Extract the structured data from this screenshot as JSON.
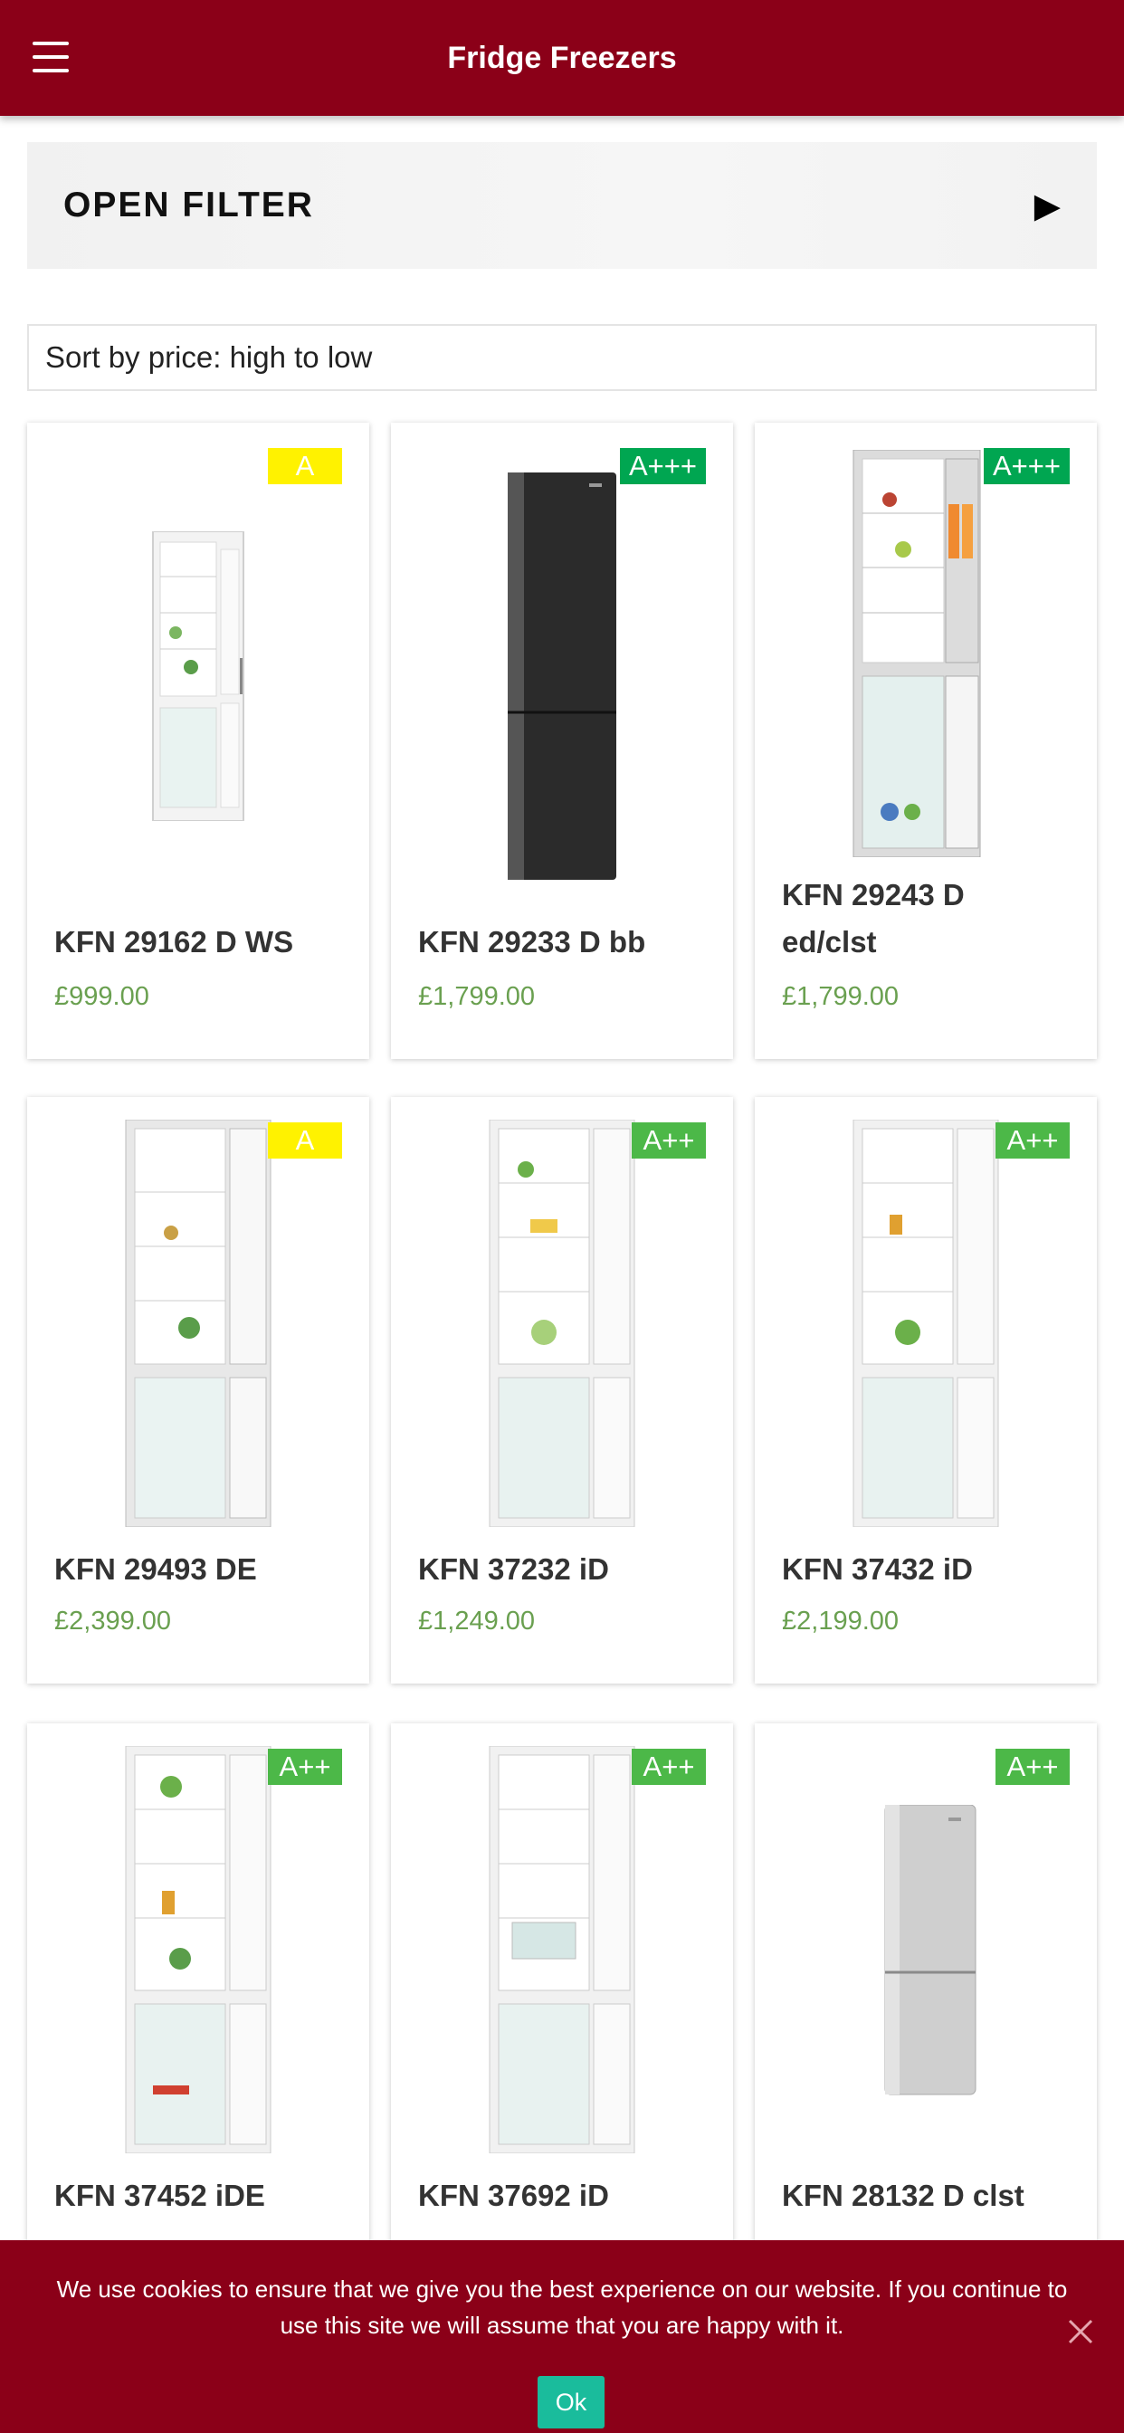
{
  "header": {
    "title": "Fridge Freezers",
    "menu_icon": "hamburger-menu-icon"
  },
  "filter": {
    "label": "OPEN FILTER",
    "icon": "triangle-right-icon"
  },
  "sort": {
    "selected": "Sort by price: high to low"
  },
  "products": [
    {
      "name": "KFN 29162 D WS",
      "price": "£999.00",
      "energy": "A"
    },
    {
      "name": "KFN 29233 D bb",
      "price": "£1,799.00",
      "energy": "A+++"
    },
    {
      "name": "KFN 29243 D ed/clst",
      "price": "£1,799.00",
      "energy": "A+++"
    },
    {
      "name": "KFN 29493 DE",
      "price": "£2,399.00",
      "energy": "A"
    },
    {
      "name": "KFN 37232 iD",
      "price": "£1,249.00",
      "energy": "A++"
    },
    {
      "name": "KFN 37432 iD",
      "price": "£2,199.00",
      "energy": "A++"
    },
    {
      "name": "KFN 37452 iDE",
      "energy": "A++"
    },
    {
      "name": "KFN 37692 iD",
      "energy": "A++"
    },
    {
      "name": "KFN 28132 D clst",
      "energy": "A++"
    }
  ],
  "colors": {
    "brand": "#8b0018",
    "price": "#6aa050",
    "energy_a": "#fff200",
    "energy_a3": "#00a651",
    "energy_a2": "#4cb848",
    "ok_button": "#1abc9c"
  },
  "cookie": {
    "text": "We use cookies to ensure that we give you the best experience on our website. If you continue to use this site we will assume that you are happy with it.",
    "ok_label": "Ok",
    "close_icon": "close-icon"
  }
}
